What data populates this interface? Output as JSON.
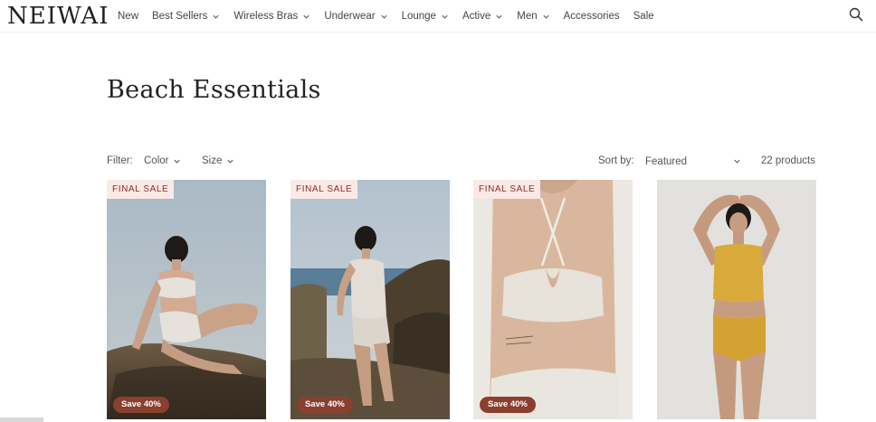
{
  "brand": {
    "logo": "NEIWAI"
  },
  "nav": {
    "items": [
      {
        "label": "New",
        "dropdown": false
      },
      {
        "label": "Best Sellers",
        "dropdown": true
      },
      {
        "label": "Wireless Bras",
        "dropdown": true
      },
      {
        "label": "Underwear",
        "dropdown": true
      },
      {
        "label": "Lounge",
        "dropdown": true
      },
      {
        "label": "Active",
        "dropdown": true
      },
      {
        "label": "Men",
        "dropdown": true
      },
      {
        "label": "Accessories",
        "dropdown": false
      },
      {
        "label": "Sale",
        "dropdown": false
      }
    ],
    "search_icon": "search-icon"
  },
  "page": {
    "title": "Beach Essentials"
  },
  "toolbar": {
    "filter_label": "Filter:",
    "filters": [
      {
        "label": "Color"
      },
      {
        "label": "Size"
      }
    ],
    "sort_label": "Sort by:",
    "sort_value": "Featured",
    "count": "22 products"
  },
  "products": [
    {
      "top_badge": "FINAL SALE",
      "bottom_badge": "Save 40%"
    },
    {
      "top_badge": "FINAL SALE",
      "bottom_badge": "Save 40%"
    },
    {
      "top_badge": "FINAL SALE",
      "bottom_badge": "Save 40%"
    },
    {
      "top_badge": "",
      "bottom_badge": ""
    }
  ],
  "colors": {
    "final_sale_bg": "#fbe9e6",
    "final_sale_text": "#8b2e26",
    "save_badge_bg": "#8a3f2f"
  }
}
